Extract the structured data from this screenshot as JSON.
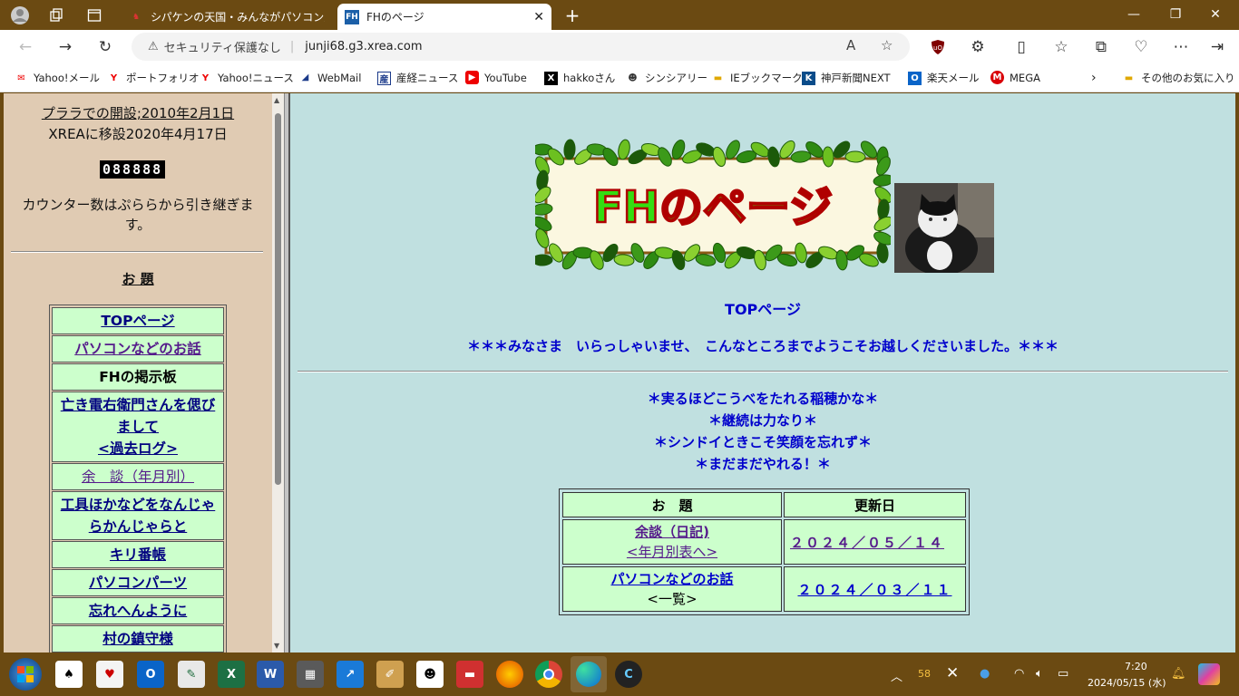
{
  "browser": {
    "tabs": [
      {
        "title": "シパケンの天国・みんながパソコン大王",
        "active": false
      },
      {
        "title": "FHのページ",
        "active": true
      }
    ],
    "new_tab": "+",
    "address": {
      "security": "セキュリティ保護なし",
      "url": "junji68.g3.xrea.com"
    },
    "bookmarks": [
      {
        "label": "Yahoo!メール",
        "icon": "yahoo-mail-icon"
      },
      {
        "label": "ポートフォリオ",
        "icon": "yahoo-icon"
      },
      {
        "label": "Yahoo!ニュース",
        "icon": "yahoo-icon"
      },
      {
        "label": "WebMail",
        "icon": "webmail-icon"
      },
      {
        "label": "産経ニュース",
        "icon": "sankei-icon"
      },
      {
        "label": "YouTube",
        "icon": "youtube-icon"
      },
      {
        "label": "hakkoさん",
        "icon": "x-icon"
      },
      {
        "label": "シンシアリー",
        "icon": "avatar-icon"
      },
      {
        "label": "IEブックマーク",
        "icon": "folder-icon"
      },
      {
        "label": "神戸新聞NEXT",
        "icon": "kobe-icon"
      },
      {
        "label": "楽天メール",
        "icon": "outlook-icon"
      },
      {
        "label": "MEGA",
        "icon": "mega-icon"
      }
    ],
    "other_favorites": "その他のお気に入り",
    "colors": {
      "frame": "#6b4a12",
      "left_bg": "#e0cbb3",
      "right_bg": "#c0e0e0",
      "menu_bg": "#ccffcc",
      "link": "#0000cc"
    }
  },
  "left": {
    "opened": "プララでの開設;2010年2月1日",
    "moved": "XREAに移設2020年4月17日",
    "counter": "088888",
    "counter_note": "カウンター数はぷららから引き継ぎます。",
    "menu_title": "お 題",
    "menu": [
      {
        "lines": [
          "TOPページ"
        ],
        "style": "link"
      },
      {
        "lines": [
          "パソコンなどのお話"
        ],
        "style": "visited"
      },
      {
        "lines": [
          "FHの掲示板"
        ],
        "style": "plain"
      },
      {
        "lines": [
          "亡き電右衛門さんを偲び",
          "まして",
          "<過去ログ>"
        ],
        "style": "link"
      },
      {
        "lines": [
          "余　談（年月別）"
        ],
        "style": "light"
      },
      {
        "lines": [
          "工具ほかなどをなんじゃ",
          "らかんじゃらと"
        ],
        "style": "link"
      },
      {
        "lines": [
          "キリ番帳"
        ],
        "style": "link"
      },
      {
        "lines": [
          "パソコンパーツ"
        ],
        "style": "link"
      },
      {
        "lines": [
          "忘れへんように"
        ],
        "style": "link"
      },
      {
        "lines": [
          "村の鎮守様"
        ],
        "style": "link"
      }
    ]
  },
  "right": {
    "logo_text": "FHのページ",
    "top_label": "TOPページ",
    "welcome": "＊＊＊みなさま　いらっしゃいませ、　こんなところまでようこそお越しくださいました。＊＊＊",
    "mottos": [
      "＊実るほどこうべをたれる稲穂かな＊",
      "＊継続は力なり＊",
      "＊シンドイときこそ笑顔を忘れず＊",
      "＊まだまだやれる！＊"
    ],
    "table": {
      "headers": [
        "お　題",
        "更新日"
      ],
      "rows": [
        {
          "title": "余談（日記)",
          "sub": "<年月別表へ>",
          "date": "２０２４／０５／１４"
        },
        {
          "title": "パソコンなどのお話",
          "sub": "<一覧>",
          "date": "２０２４／０３／１１"
        }
      ]
    }
  },
  "taskbar": {
    "badge": "58",
    "time": "7:20",
    "date": "2024/05/15 (水)"
  }
}
